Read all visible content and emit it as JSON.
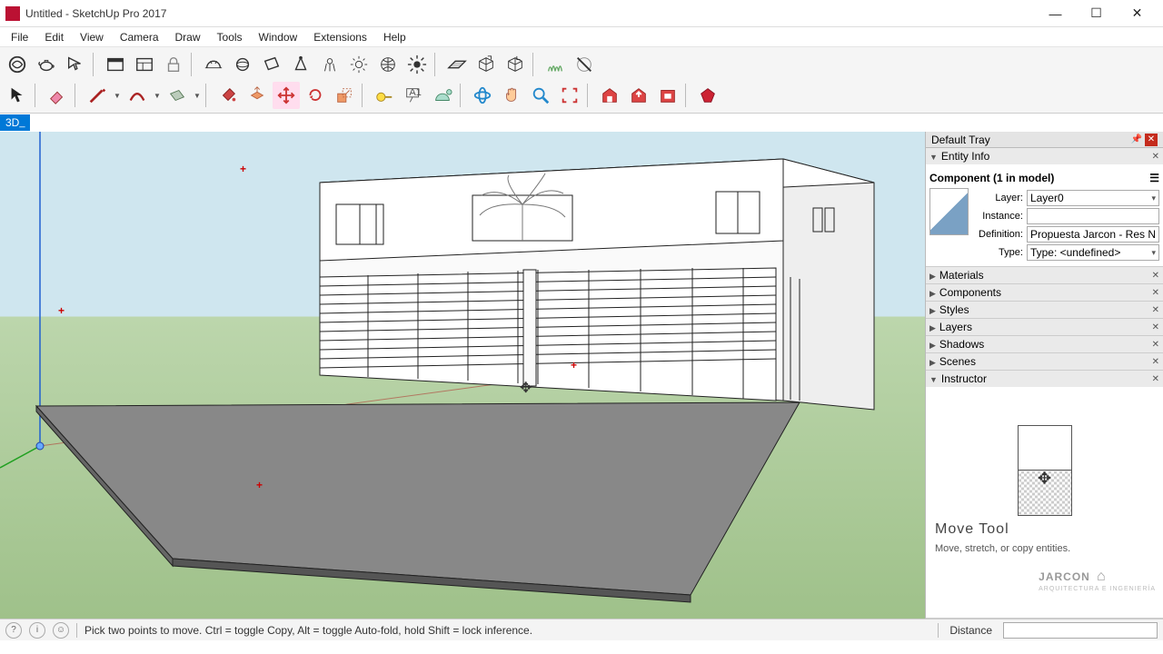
{
  "window": {
    "title": "Untitled - SketchUp Pro 2017"
  },
  "menus": [
    "File",
    "Edit",
    "View",
    "Camera",
    "Draw",
    "Tools",
    "Window",
    "Extensions",
    "Help"
  ],
  "layerTag": "3D",
  "tray": {
    "title": "Default Tray",
    "entityInfo": {
      "panel": "Entity Info",
      "heading": "Component (1 in model)",
      "layerLabel": "Layer:",
      "layerValue": "Layer0",
      "instanceLabel": "Instance:",
      "instanceValue": "",
      "definitionLabel": "Definition:",
      "definitionValue": "Propuesta Jarcon - Res N",
      "typeLabel": "Type:",
      "typeValue": "Type: <undefined>"
    },
    "collapsedPanels": [
      "Materials",
      "Components",
      "Styles",
      "Layers",
      "Shadows",
      "Scenes"
    ],
    "instructor": {
      "panel": "Instructor",
      "toolName": "Move Tool",
      "toolDesc": "Move, stretch, or copy entities."
    }
  },
  "watermark": {
    "brand": "JARCON",
    "tagline": "ARQUITECTURA E INGENIERÍA"
  },
  "status": {
    "hint": "Pick two points to move.  Ctrl = toggle Copy, Alt = toggle Auto-fold, hold Shift = lock inference.",
    "measureLabel": "Distance"
  }
}
